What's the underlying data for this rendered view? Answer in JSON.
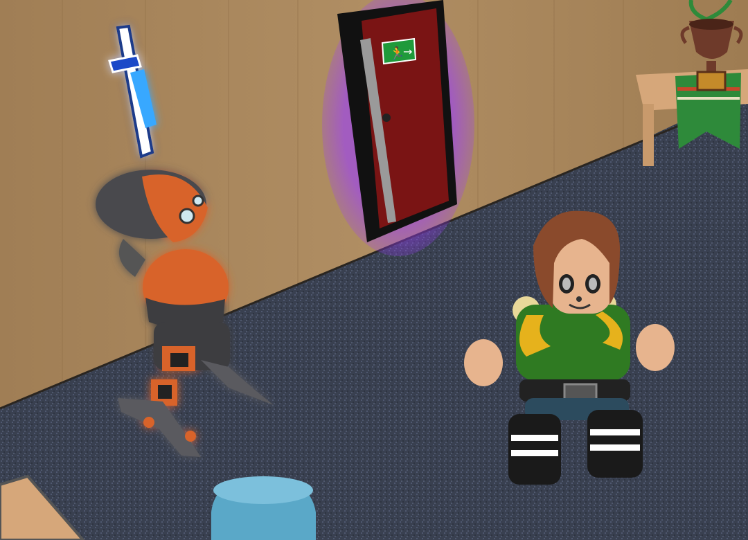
{
  "scene": {
    "description_free": true,
    "colors": {
      "wall": "#a8865c",
      "wall_dark": "#8a6c48",
      "carpet": "#3a4150",
      "door_frame": "#111111",
      "door": "#7a1414",
      "door_glow": "#9a3cff",
      "robot_orange": "#d8642a",
      "robot_gray": "#4a4a4e",
      "item_glow": "#f3ff9a",
      "shirt": "#2f7a22",
      "straps": "#e6b21c",
      "hair": "#8a4a2c",
      "skin": "#e7b48e",
      "pants": "#2c4b5e",
      "shoes": "#1a1a1a",
      "trophy": "#6e3a2a",
      "banner_green": "#2e8a3a",
      "banner_stripe": "#c8462a",
      "table": "#d6a77a",
      "stool": "#5aa8c8"
    },
    "exit_sign": {
      "icon": "running-man-exit-icon",
      "arrow": "arrow-right-icon",
      "color": "#1f9a3a"
    },
    "objects": [
      {
        "name": "exit-door",
        "icon": "door-icon"
      },
      {
        "name": "robot-outfit",
        "icon": "robot-icon"
      },
      {
        "name": "sword-item",
        "icon": "sword-icon"
      },
      {
        "name": "trophy",
        "icon": "trophy-icon"
      },
      {
        "name": "player-avatar",
        "icon": "avatar-icon"
      },
      {
        "name": "stool",
        "icon": "stool-icon"
      },
      {
        "name": "wooden-table",
        "icon": "table-icon"
      }
    ]
  }
}
